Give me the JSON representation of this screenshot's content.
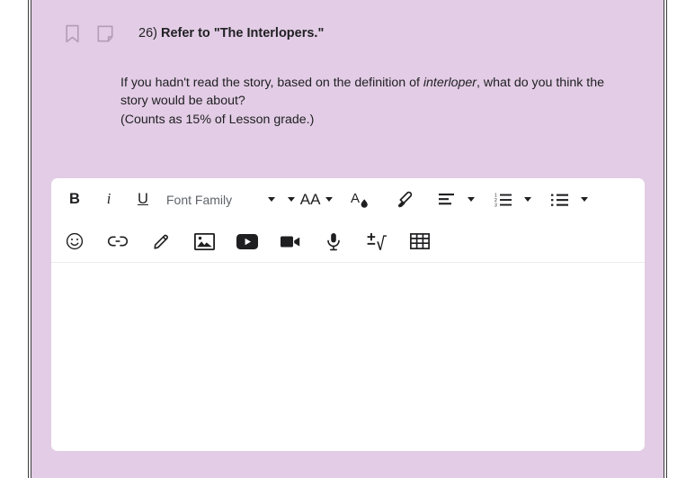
{
  "theme": {
    "card_background": "#e3cce5",
    "page_background": "#ffffff",
    "editor_background": "#ffffff",
    "text_color": "#202124",
    "placeholder_color": "#5f6368",
    "frame_rule_color": "#3c3c3c",
    "divider_color": "#ececf0"
  },
  "question": {
    "bookmark_icon": "bookmark-icon",
    "note_icon": "sticky-note-icon",
    "number": "26)",
    "label": "Refer to \"The Interlopers.\"",
    "prompt_part1": "If you hadn't read the story, based on the definition of ",
    "prompt_emphasis": "interloper",
    "prompt_part2": ", what do you think the story would be about?",
    "grade_note": "(Counts as 15% of Lesson grade.)"
  },
  "editor": {
    "toolbar_row1": {
      "bold_label": "B",
      "italic_label": "i",
      "underline_label": "U",
      "font_family_placeholder": "Font Family",
      "font_size_label": "AA",
      "text_color_icon": "text-color-icon",
      "highlighter_icon": "highlighter-icon",
      "align_icon": "align-left-icon",
      "numbered_list_icon": "numbered-list-icon",
      "bulleted_list_icon": "bulleted-list-icon"
    },
    "toolbar_row2": {
      "emoji_icon": "emoji-icon",
      "link_icon": "link-icon",
      "draw_icon": "pencil-draw-icon",
      "image_icon": "image-icon",
      "youtube_icon": "youtube-icon",
      "video_icon": "video-camera-icon",
      "audio_icon": "microphone-icon",
      "math_icon": "math-equation-icon",
      "table_icon": "table-icon"
    },
    "canvas_value": "",
    "canvas_placeholder": ""
  }
}
